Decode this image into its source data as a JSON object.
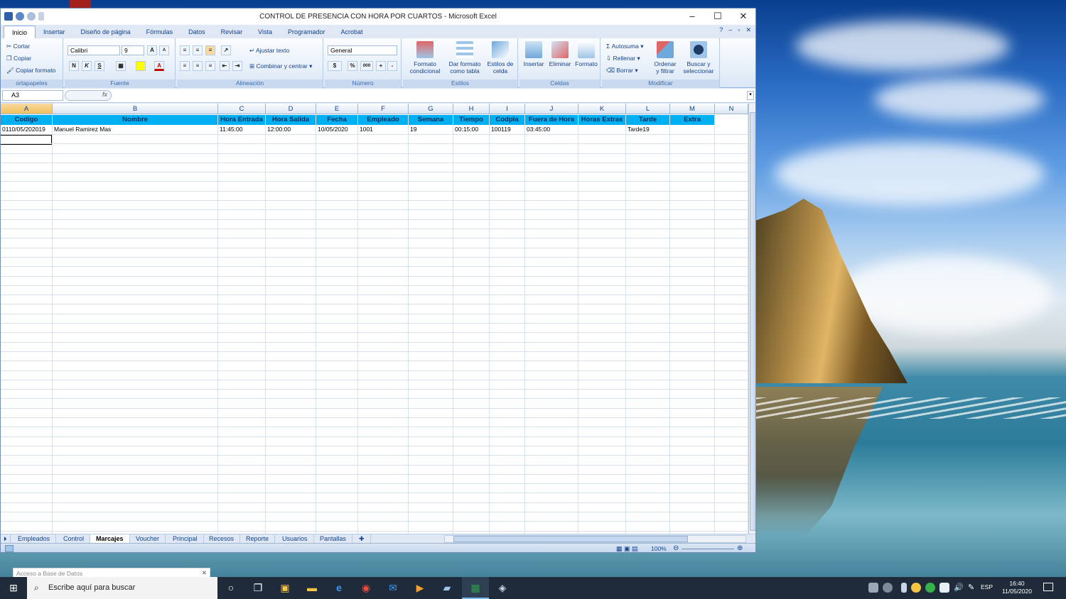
{
  "window": {
    "title": "CONTROL DE PRESENCIA CON HORA POR CUARTOS - Microsoft Excel",
    "minimize": "–",
    "maximize": "☐",
    "close": "✕"
  },
  "ribbon": {
    "tabs": [
      "Inicio",
      "Insertar",
      "Diseño de página",
      "Fórmulas",
      "Datos",
      "Revisar",
      "Vista",
      "Programador",
      "Acrobat"
    ],
    "clipboard": {
      "cut": "Cortar",
      "copy": "Copiar",
      "format_painter": "Copiar formato",
      "label": "ortapapeles"
    },
    "font": {
      "name": "Calibri",
      "size": "9",
      "bold": "N",
      "italic": "K",
      "underline": "S",
      "label": "Fuente"
    },
    "alignment": {
      "wrap": "Ajustar texto",
      "merge": "Combinar y centrar",
      "label": "Alineación"
    },
    "number": {
      "format": "General",
      "percent": "%",
      "thousands": "000",
      "label": "Número"
    },
    "styles": {
      "cond1": "Formato",
      "cond2": "condicional",
      "table1": "Dar formato",
      "table2": "como tabla",
      "cell1": "Estilos de",
      "cell2": "celda",
      "label": "Estilos"
    },
    "cells": {
      "insert": "Insertar",
      "delete": "Eliminar",
      "format": "Formato",
      "label": "Celdas"
    },
    "editing": {
      "autosum": "Autosuma",
      "fill": "Rellenar",
      "clear": "Borrar",
      "sort1": "Ordenar",
      "sort2": "y filtrar",
      "find1": "Buscar y",
      "find2": "seleccionar",
      "label": "Modificar"
    }
  },
  "formula_bar": {
    "name_box": "A3",
    "fx": "fx",
    "value": ""
  },
  "columns": [
    "A",
    "B",
    "C",
    "D",
    "E",
    "F",
    "G",
    "H",
    "I",
    "J",
    "K",
    "L",
    "M",
    "N"
  ],
  "headers": [
    "Codigo",
    "Nombre",
    "Hora Entrada",
    "Hora Salida",
    "Fecha",
    "Empleado",
    "Semana",
    "Tiempo",
    "Codpla",
    "Fuera de Hora",
    "Horas Extras",
    "Tarde",
    "Extra"
  ],
  "rows": [
    [
      "0110/05/202019",
      "Manuel Ramirez Mas",
      "11:45:00",
      "12:00:00",
      "10/05/2020",
      "1001",
      "19",
      "00:15:00",
      "100119",
      "03:45:00",
      "",
      "Tarde19",
      ""
    ]
  ],
  "sheets": [
    "Empleados",
    "Control",
    "Marcajes",
    "Voucher",
    "Principal",
    "Recesos",
    "Reporte",
    "Usuarios",
    "Pantallas"
  ],
  "active_sheet": "Marcajes",
  "status": {
    "zoom": "100%"
  },
  "access_bar": {
    "label": "Acceso a Base de Datos"
  },
  "taskbar": {
    "search_placeholder": "Escribe aquí para buscar",
    "lang": "ESP",
    "time": "16:40",
    "date": "11/05/2020"
  }
}
